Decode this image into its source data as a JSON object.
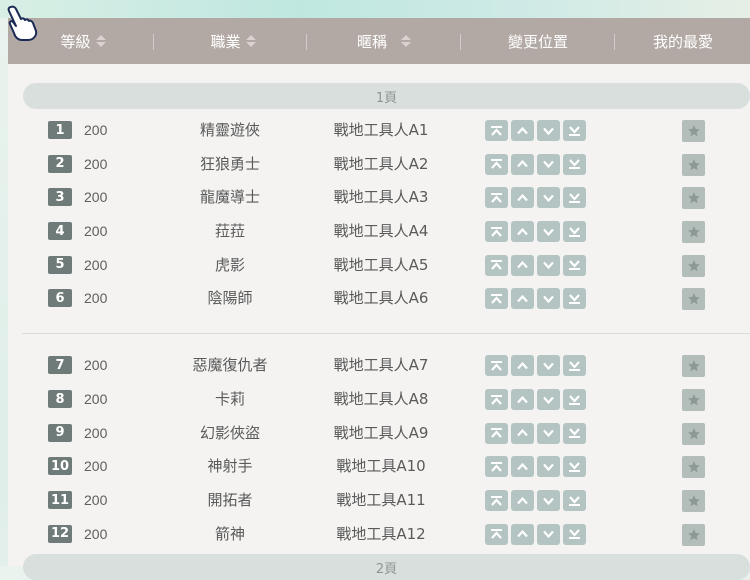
{
  "header": {
    "level": "等級",
    "job": "職業",
    "nickname": "暱稱",
    "move": "變更位置",
    "favorite": "我的最愛"
  },
  "pages": [
    {
      "label": "1頁",
      "rows": [
        {
          "index": "1",
          "level": "200",
          "job": "精靈遊俠",
          "nickname": "戰地工具人A1"
        },
        {
          "index": "2",
          "level": "200",
          "job": "狂狼勇士",
          "nickname": "戰地工具人A2"
        },
        {
          "index": "3",
          "level": "200",
          "job": "龍魔導士",
          "nickname": "戰地工具人A3"
        },
        {
          "index": "4",
          "level": "200",
          "job": "菈菈",
          "nickname": "戰地工具人A4"
        },
        {
          "index": "5",
          "level": "200",
          "job": "虎影",
          "nickname": "戰地工具人A5"
        },
        {
          "index": "6",
          "level": "200",
          "job": "陰陽師",
          "nickname": "戰地工具人A6"
        },
        {
          "index": "7",
          "level": "200",
          "job": "惡魔復仇者",
          "nickname": "戰地工具人A7"
        },
        {
          "index": "8",
          "level": "200",
          "job": "卡莉",
          "nickname": "戰地工具人A8"
        },
        {
          "index": "9",
          "level": "200",
          "job": "幻影俠盜",
          "nickname": "戰地工具人A9"
        },
        {
          "index": "10",
          "level": "200",
          "job": "神射手",
          "nickname": "戰地工具A10"
        },
        {
          "index": "11",
          "level": "200",
          "job": "開拓者",
          "nickname": "戰地工具A11"
        },
        {
          "index": "12",
          "level": "200",
          "job": "箭神",
          "nickname": "戰地工具A12"
        }
      ]
    },
    {
      "label": "2頁"
    }
  ],
  "icons": {
    "move_top": "move-to-top-icon",
    "move_up": "move-up-icon",
    "move_down": "move-down-icon",
    "move_bottom": "move-to-bottom-icon",
    "favorite": "star-icon",
    "sort": "sort-icon",
    "cursor": "pointer-cursor-icon"
  },
  "colors": {
    "header_bg": "#b3a9a4",
    "index_badge": "#6f7b78",
    "move_button": "#b4c4c2",
    "favorite_button": "#b3bdba",
    "page_bar": "#d8dfdd"
  }
}
